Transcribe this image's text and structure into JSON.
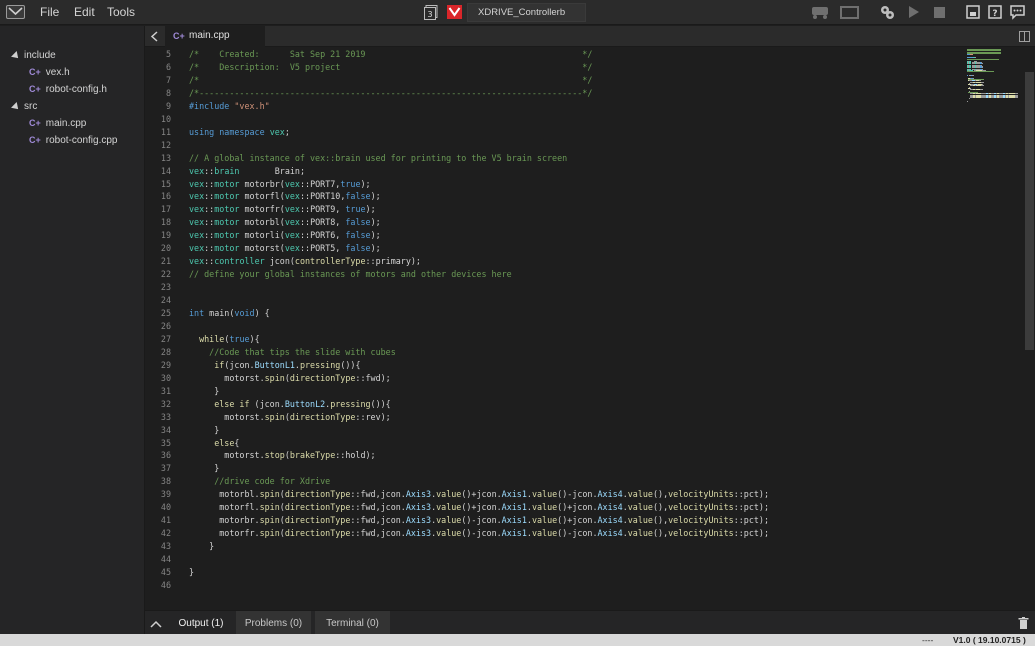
{
  "menubar": {
    "logo": "vex-logo-icon",
    "menus": [
      "File",
      "Edit",
      "Tools"
    ],
    "slot_number": "3",
    "brain_icon": "vex-brain-icon",
    "project_name": "XDRIVE_Controllerb",
    "tools": [
      "robot-icon",
      "screen-icon",
      "gears-icon",
      "play-icon",
      "stop-icon",
      "device-icon",
      "help-icon",
      "feedback-icon"
    ]
  },
  "sidebar": {
    "folders": [
      {
        "name": "include",
        "files": [
          "vex.h",
          "robot-config.h"
        ]
      },
      {
        "name": "src",
        "files": [
          "main.cpp",
          "robot-config.cpp"
        ]
      }
    ],
    "file_icon_glyph": "C+"
  },
  "editor": {
    "tab": "main.cpp",
    "lines": [
      {
        "n": 5,
        "t": [
          [
            "c",
            "/*    Created:      Sat Sep 21 2019                                           */"
          ]
        ]
      },
      {
        "n": 6,
        "t": [
          [
            "c",
            "/*    Description:  V5 project                                                */"
          ]
        ]
      },
      {
        "n": 7,
        "t": [
          [
            "c",
            "/*                                                                            */"
          ]
        ]
      },
      {
        "n": 8,
        "t": [
          [
            "c",
            "/*----------------------------------------------------------------------------*/"
          ]
        ]
      },
      {
        "n": 9,
        "t": [
          [
            "k",
            "#include "
          ],
          [
            "s",
            "\"vex.h\""
          ]
        ]
      },
      {
        "n": 10,
        "t": []
      },
      {
        "n": 11,
        "t": [
          [
            "k",
            "using namespace "
          ],
          [
            "t",
            "vex"
          ],
          [
            "n",
            ";"
          ]
        ]
      },
      {
        "n": 12,
        "t": []
      },
      {
        "n": 13,
        "t": [
          [
            "c",
            "// A global instance of vex::brain used for printing to the V5 brain screen"
          ]
        ]
      },
      {
        "n": 14,
        "t": [
          [
            "t",
            "vex"
          ],
          [
            "n",
            "::"
          ],
          [
            "t",
            "brain"
          ],
          [
            "n",
            "       Brain;"
          ]
        ]
      },
      {
        "n": 15,
        "t": [
          [
            "t",
            "vex"
          ],
          [
            "n",
            "::"
          ],
          [
            "t",
            "motor"
          ],
          [
            "n",
            " motorbr("
          ],
          [
            "t",
            "vex"
          ],
          [
            "n",
            "::PORT7,"
          ],
          [
            "k",
            "true"
          ],
          [
            "n",
            ");"
          ]
        ]
      },
      {
        "n": 16,
        "t": [
          [
            "t",
            "vex"
          ],
          [
            "n",
            "::"
          ],
          [
            "t",
            "motor"
          ],
          [
            "n",
            " motorfl("
          ],
          [
            "t",
            "vex"
          ],
          [
            "n",
            "::PORT10,"
          ],
          [
            "k",
            "false"
          ],
          [
            "n",
            ");"
          ]
        ]
      },
      {
        "n": 17,
        "t": [
          [
            "t",
            "vex"
          ],
          [
            "n",
            "::"
          ],
          [
            "t",
            "motor"
          ],
          [
            "n",
            " motorfr("
          ],
          [
            "t",
            "vex"
          ],
          [
            "n",
            "::PORT9, "
          ],
          [
            "k",
            "true"
          ],
          [
            "n",
            ");"
          ]
        ]
      },
      {
        "n": 18,
        "t": [
          [
            "t",
            "vex"
          ],
          [
            "n",
            "::"
          ],
          [
            "t",
            "motor"
          ],
          [
            "n",
            " motorbl("
          ],
          [
            "t",
            "vex"
          ],
          [
            "n",
            "::PORT8, "
          ],
          [
            "k",
            "false"
          ],
          [
            "n",
            ");"
          ]
        ]
      },
      {
        "n": 19,
        "t": [
          [
            "t",
            "vex"
          ],
          [
            "n",
            "::"
          ],
          [
            "t",
            "motor"
          ],
          [
            "n",
            " motorli("
          ],
          [
            "t",
            "vex"
          ],
          [
            "n",
            "::PORT6, "
          ],
          [
            "k",
            "false"
          ],
          [
            "n",
            ");"
          ]
        ]
      },
      {
        "n": 20,
        "t": [
          [
            "t",
            "vex"
          ],
          [
            "n",
            "::"
          ],
          [
            "t",
            "motor"
          ],
          [
            "n",
            " motorst("
          ],
          [
            "t",
            "vex"
          ],
          [
            "n",
            "::PORT5, "
          ],
          [
            "k",
            "false"
          ],
          [
            "n",
            ");"
          ]
        ]
      },
      {
        "n": 21,
        "t": [
          [
            "t",
            "vex"
          ],
          [
            "n",
            "::"
          ],
          [
            "t",
            "controller"
          ],
          [
            "n",
            " jcon("
          ],
          [
            "f",
            "controllerType"
          ],
          [
            "n",
            "::primary);"
          ]
        ]
      },
      {
        "n": 22,
        "t": [
          [
            "c",
            "// define your global instances of motors and other devices here"
          ]
        ]
      },
      {
        "n": 23,
        "t": []
      },
      {
        "n": 24,
        "t": []
      },
      {
        "n": 25,
        "t": [
          [
            "k",
            "int"
          ],
          [
            "n",
            " main("
          ],
          [
            "k",
            "void"
          ],
          [
            "n",
            ") {"
          ]
        ]
      },
      {
        "n": 26,
        "t": []
      },
      {
        "n": 27,
        "t": [
          [
            "n",
            "  "
          ],
          [
            "f",
            "while"
          ],
          [
            "n",
            "("
          ],
          [
            "k",
            "true"
          ],
          [
            "n",
            "){"
          ]
        ]
      },
      {
        "n": 28,
        "t": [
          [
            "n",
            "    "
          ],
          [
            "c",
            "//Code that tips the slide with cubes"
          ]
        ]
      },
      {
        "n": 29,
        "t": [
          [
            "n",
            "     "
          ],
          [
            "f",
            "if"
          ],
          [
            "n",
            "(jcon."
          ],
          [
            "p",
            "ButtonL1"
          ],
          [
            "n",
            "."
          ],
          [
            "f",
            "pressing"
          ],
          [
            "n",
            "()){"
          ]
        ]
      },
      {
        "n": 30,
        "t": [
          [
            "n",
            "       motorst."
          ],
          [
            "f",
            "spin"
          ],
          [
            "n",
            "("
          ],
          [
            "f",
            "directionType"
          ],
          [
            "n",
            "::fwd);"
          ]
        ]
      },
      {
        "n": 31,
        "t": [
          [
            "n",
            "     }"
          ]
        ]
      },
      {
        "n": 32,
        "t": [
          [
            "n",
            "     "
          ],
          [
            "f",
            "else if"
          ],
          [
            "n",
            " (jcon."
          ],
          [
            "p",
            "ButtonL2"
          ],
          [
            "n",
            "."
          ],
          [
            "f",
            "pressing"
          ],
          [
            "n",
            "()){"
          ]
        ]
      },
      {
        "n": 33,
        "t": [
          [
            "n",
            "       motorst."
          ],
          [
            "f",
            "spin"
          ],
          [
            "n",
            "("
          ],
          [
            "f",
            "directionType"
          ],
          [
            "n",
            "::rev);"
          ]
        ]
      },
      {
        "n": 34,
        "t": [
          [
            "n",
            "     }"
          ]
        ]
      },
      {
        "n": 35,
        "t": [
          [
            "n",
            "     "
          ],
          [
            "f",
            "else"
          ],
          [
            "n",
            "{"
          ]
        ]
      },
      {
        "n": 36,
        "t": [
          [
            "n",
            "       motorst."
          ],
          [
            "f",
            "stop"
          ],
          [
            "n",
            "("
          ],
          [
            "f",
            "brakeType"
          ],
          [
            "n",
            "::hold);"
          ]
        ]
      },
      {
        "n": 37,
        "t": [
          [
            "n",
            "     }"
          ]
        ]
      },
      {
        "n": 38,
        "t": [
          [
            "n",
            "     "
          ],
          [
            "c",
            "//drive code for Xdrive"
          ]
        ]
      },
      {
        "n": 39,
        "t": [
          [
            "n",
            "      motorbl."
          ],
          [
            "f",
            "spin"
          ],
          [
            "n",
            "("
          ],
          [
            "f",
            "directionType"
          ],
          [
            "n",
            "::fwd,jcon."
          ],
          [
            "p",
            "Axis3"
          ],
          [
            "n",
            "."
          ],
          [
            "f",
            "value"
          ],
          [
            "n",
            "()+jcon."
          ],
          [
            "p",
            "Axis1"
          ],
          [
            "n",
            "."
          ],
          [
            "f",
            "value"
          ],
          [
            "n",
            "()-jcon."
          ],
          [
            "p",
            "Axis4"
          ],
          [
            "n",
            "."
          ],
          [
            "f",
            "value"
          ],
          [
            "n",
            "(),"
          ],
          [
            "f",
            "velocityUnits"
          ],
          [
            "n",
            "::pct);"
          ]
        ]
      },
      {
        "n": 40,
        "t": [
          [
            "n",
            "      motorfl."
          ],
          [
            "f",
            "spin"
          ],
          [
            "n",
            "("
          ],
          [
            "f",
            "directionType"
          ],
          [
            "n",
            "::fwd,jcon."
          ],
          [
            "p",
            "Axis3"
          ],
          [
            "n",
            "."
          ],
          [
            "f",
            "value"
          ],
          [
            "n",
            "()+jcon."
          ],
          [
            "p",
            "Axis1"
          ],
          [
            "n",
            "."
          ],
          [
            "f",
            "value"
          ],
          [
            "n",
            "()+jcon."
          ],
          [
            "p",
            "Axis4"
          ],
          [
            "n",
            "."
          ],
          [
            "f",
            "value"
          ],
          [
            "n",
            "(),"
          ],
          [
            "f",
            "velocityUnits"
          ],
          [
            "n",
            "::pct);"
          ]
        ]
      },
      {
        "n": 41,
        "t": [
          [
            "n",
            "      motorbr."
          ],
          [
            "f",
            "spin"
          ],
          [
            "n",
            "("
          ],
          [
            "f",
            "directionType"
          ],
          [
            "n",
            "::fwd,jcon."
          ],
          [
            "p",
            "Axis3"
          ],
          [
            "n",
            "."
          ],
          [
            "f",
            "value"
          ],
          [
            "n",
            "()-jcon."
          ],
          [
            "p",
            "Axis1"
          ],
          [
            "n",
            "."
          ],
          [
            "f",
            "value"
          ],
          [
            "n",
            "()+jcon."
          ],
          [
            "p",
            "Axis4"
          ],
          [
            "n",
            "."
          ],
          [
            "f",
            "value"
          ],
          [
            "n",
            "(),"
          ],
          [
            "f",
            "velocityUnits"
          ],
          [
            "n",
            "::pct);"
          ]
        ]
      },
      {
        "n": 42,
        "t": [
          [
            "n",
            "      motorfr."
          ],
          [
            "f",
            "spin"
          ],
          [
            "n",
            "("
          ],
          [
            "f",
            "directionType"
          ],
          [
            "n",
            "::fwd,jcon."
          ],
          [
            "p",
            "Axis3"
          ],
          [
            "n",
            "."
          ],
          [
            "f",
            "value"
          ],
          [
            "n",
            "()-jcon."
          ],
          [
            "p",
            "Axis1"
          ],
          [
            "n",
            "."
          ],
          [
            "f",
            "value"
          ],
          [
            "n",
            "()-jcon."
          ],
          [
            "p",
            "Axis4"
          ],
          [
            "n",
            "."
          ],
          [
            "f",
            "value"
          ],
          [
            "n",
            "(),"
          ],
          [
            "f",
            "velocityUnits"
          ],
          [
            "n",
            "::pct);"
          ]
        ]
      },
      {
        "n": 43,
        "t": [
          [
            "n",
            "    }"
          ]
        ]
      },
      {
        "n": 44,
        "t": []
      },
      {
        "n": 45,
        "t": [
          [
            "n",
            "}"
          ]
        ]
      },
      {
        "n": 46,
        "t": []
      }
    ]
  },
  "panel": {
    "tabs": [
      "Output (1)",
      "Problems (0)",
      "Terminal (0)"
    ],
    "active": 0
  },
  "status": {
    "left_text": "----",
    "version": "V1.0 ( 19.10.0715 )"
  },
  "colors": {
    "comment": "#6a9955",
    "keyword": "#569cd6",
    "type": "#4ec9b0",
    "string": "#ce9178",
    "function": "#dcdcaa",
    "property": "#9cdcfe",
    "accent_red": "#d9262a"
  }
}
